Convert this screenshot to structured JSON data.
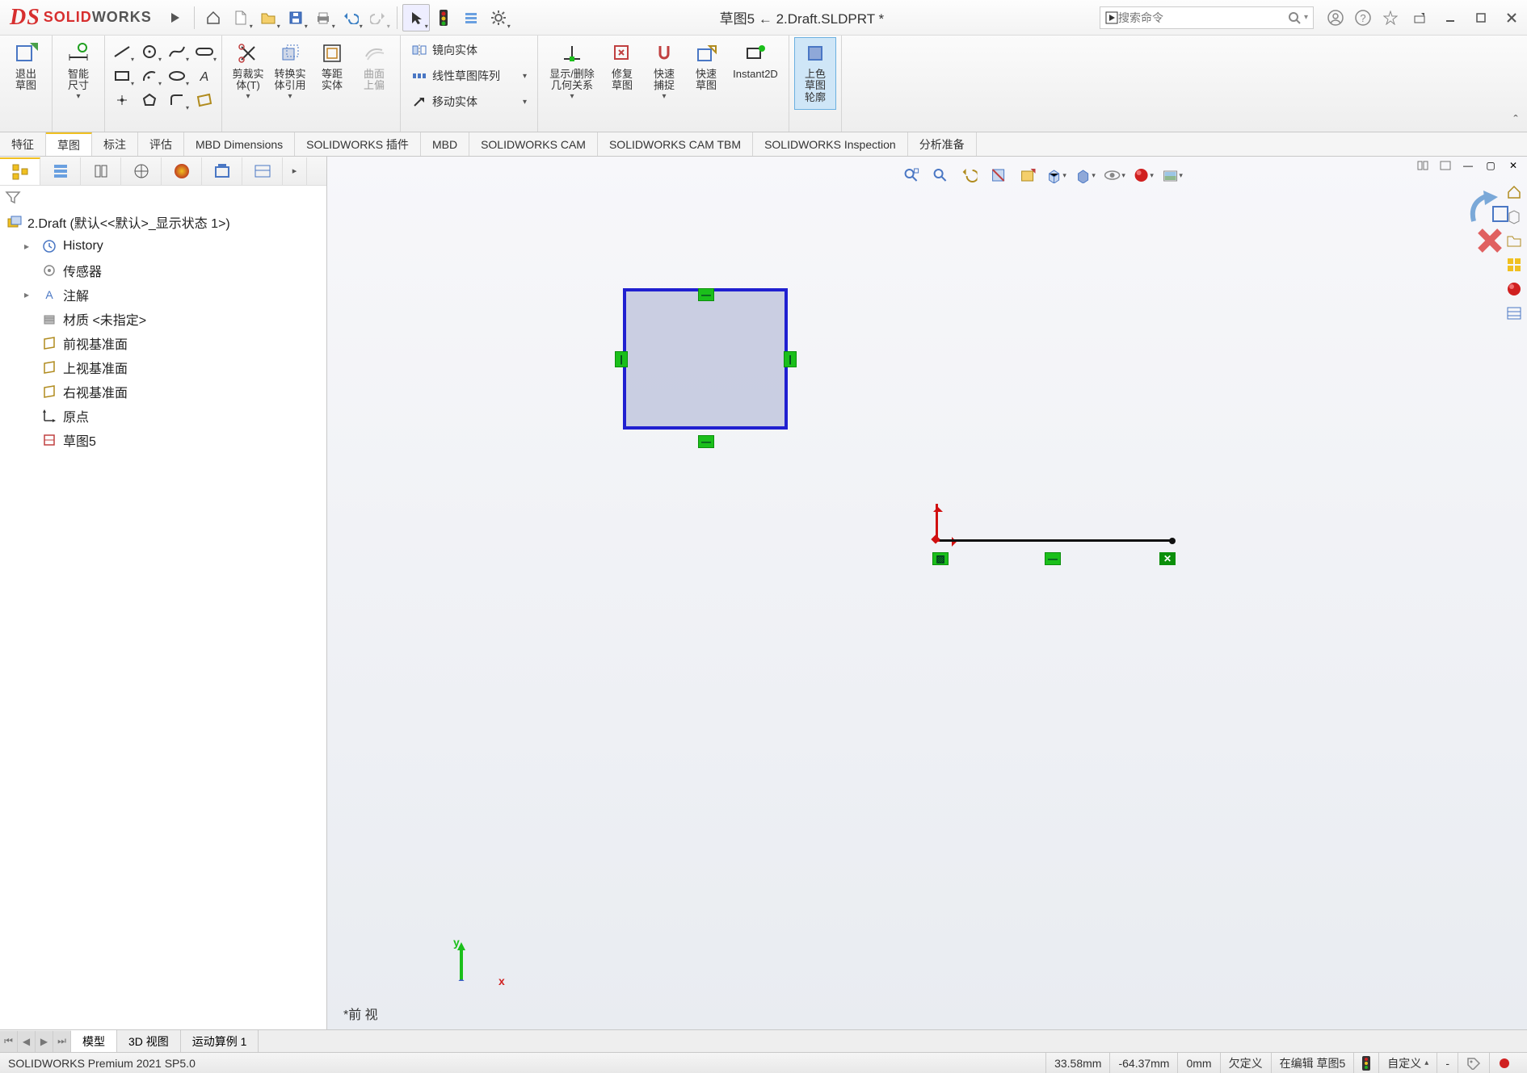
{
  "app": {
    "brand_solid": "SOLID",
    "brand_works": "WORKS"
  },
  "title": "草图5 ← 2.Draft.SLDPRT *",
  "search_placeholder": "搜索命令",
  "ribbon": {
    "exit_sketch": "退出\n草图",
    "smart_dim": "智能\n尺寸",
    "trim": "剪裁实\n体(T)",
    "convert": "转换实\n体引用",
    "offset": "等距\n实体",
    "surface_offset": "曲面\n上偏",
    "mirror": "镜向实体",
    "linear_pattern": "线性草图阵列",
    "move": "移动实体",
    "show_relations": "显示/删除\n几何关系",
    "repair": "修复\n草图",
    "quick_snap": "快速\n捕捉",
    "rapid_sketch": "快速\n草图",
    "instant2d": "Instant2D",
    "shaded_contour": "上色\n草图\n轮廓"
  },
  "tabs": [
    "特征",
    "草图",
    "标注",
    "评估",
    "MBD Dimensions",
    "SOLIDWORKS 插件",
    "MBD",
    "SOLIDWORKS CAM",
    "SOLIDWORKS CAM TBM",
    "SOLIDWORKS Inspection",
    "分析准备"
  ],
  "active_tab_index": 1,
  "tree": {
    "root": "2.Draft  (默认<<默认>_显示状态 1>)",
    "items": [
      "History",
      "传感器",
      "注解",
      "材质 <未指定>",
      "前视基准面",
      "上视基准面",
      "右视基准面",
      "原点",
      "草图5"
    ]
  },
  "view_label": "*前 视",
  "bottom_tabs": [
    "模型",
    "3D 视图",
    "运动算例 1"
  ],
  "active_bottom_tab": 0,
  "status": {
    "product": "SOLIDWORKS Premium 2021 SP5.0",
    "coord_x": "33.58mm",
    "coord_y": "-64.37mm",
    "coord_z": "0mm",
    "def": "欠定义",
    "editing": "在编辑 草图5",
    "custom": "自定义",
    "dash": "-"
  },
  "triad": {
    "x": "x",
    "y": "y"
  }
}
